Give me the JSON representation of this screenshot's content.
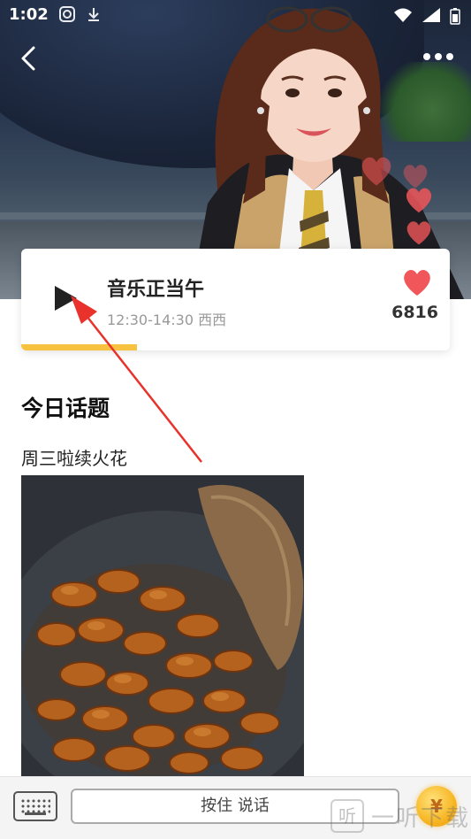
{
  "status_bar": {
    "time": "1:02"
  },
  "program": {
    "title": "音乐正当午",
    "time_host": "12:30-14:30  西西",
    "likes": "6816",
    "progress": 0.27
  },
  "topic": {
    "heading": "今日话题",
    "title": "周三啦续火花"
  },
  "bottom_bar": {
    "talk_label": "按住 说话",
    "coin_symbol": "¥"
  },
  "watermark": {
    "logo_char": "听",
    "text": "一听下载"
  },
  "colors": {
    "accent": "#f6c23f",
    "heart": "#f0565a",
    "arrow": "#e8322b"
  }
}
